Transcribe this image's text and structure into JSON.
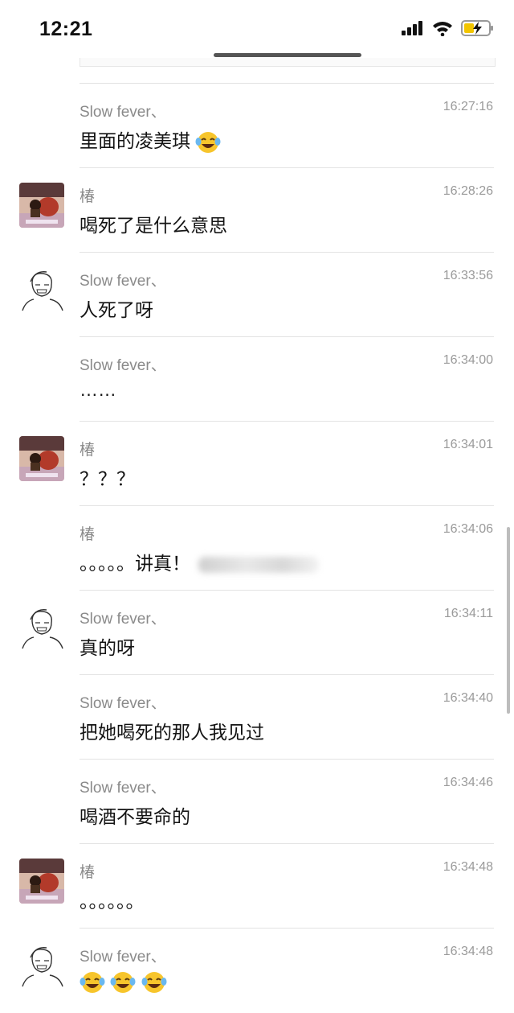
{
  "status_bar": {
    "time": "12:21",
    "icons": [
      "cellular-signal-icon",
      "wifi-icon",
      "battery-charging-icon"
    ]
  },
  "messages": [
    {
      "sender": "Slow fever、",
      "time": "16:27:16",
      "text": "里面的凌美琪",
      "avatar": "none",
      "emoji": [
        "laughing-tears-emoji"
      ]
    },
    {
      "sender": "椿",
      "time": "16:28:26",
      "text": "喝死了是什么意思",
      "avatar": "photo"
    },
    {
      "sender": "Slow fever、",
      "time": "16:33:56",
      "text": "人死了呀",
      "avatar": "sketch"
    },
    {
      "sender": "Slow fever、",
      "time": "16:34:00",
      "text": "……",
      "avatar": "none"
    },
    {
      "sender": "椿",
      "time": "16:34:01",
      "text": "？？？",
      "avatar": "photo"
    },
    {
      "sender": "椿",
      "time": "16:34:06",
      "text": "。。。。。讲真！",
      "avatar": "none",
      "blurred_tail": true
    },
    {
      "sender": "Slow fever、",
      "time": "16:34:11",
      "text": "真的呀",
      "avatar": "sketch"
    },
    {
      "sender": "Slow fever、",
      "time": "16:34:40",
      "text": "把她喝死的那人我见过",
      "avatar": "none"
    },
    {
      "sender": "Slow fever、",
      "time": "16:34:46",
      "text": "喝酒不要命的",
      "avatar": "none"
    },
    {
      "sender": "椿",
      "time": "16:34:48",
      "text": "。。。。。。",
      "avatar": "photo"
    },
    {
      "sender": "Slow fever、",
      "time": "16:34:48",
      "text": "",
      "avatar": "sketch",
      "emoji": [
        "laughing-tears-emoji",
        "laughing-tears-emoji",
        "laughing-tears-emoji"
      ]
    }
  ]
}
